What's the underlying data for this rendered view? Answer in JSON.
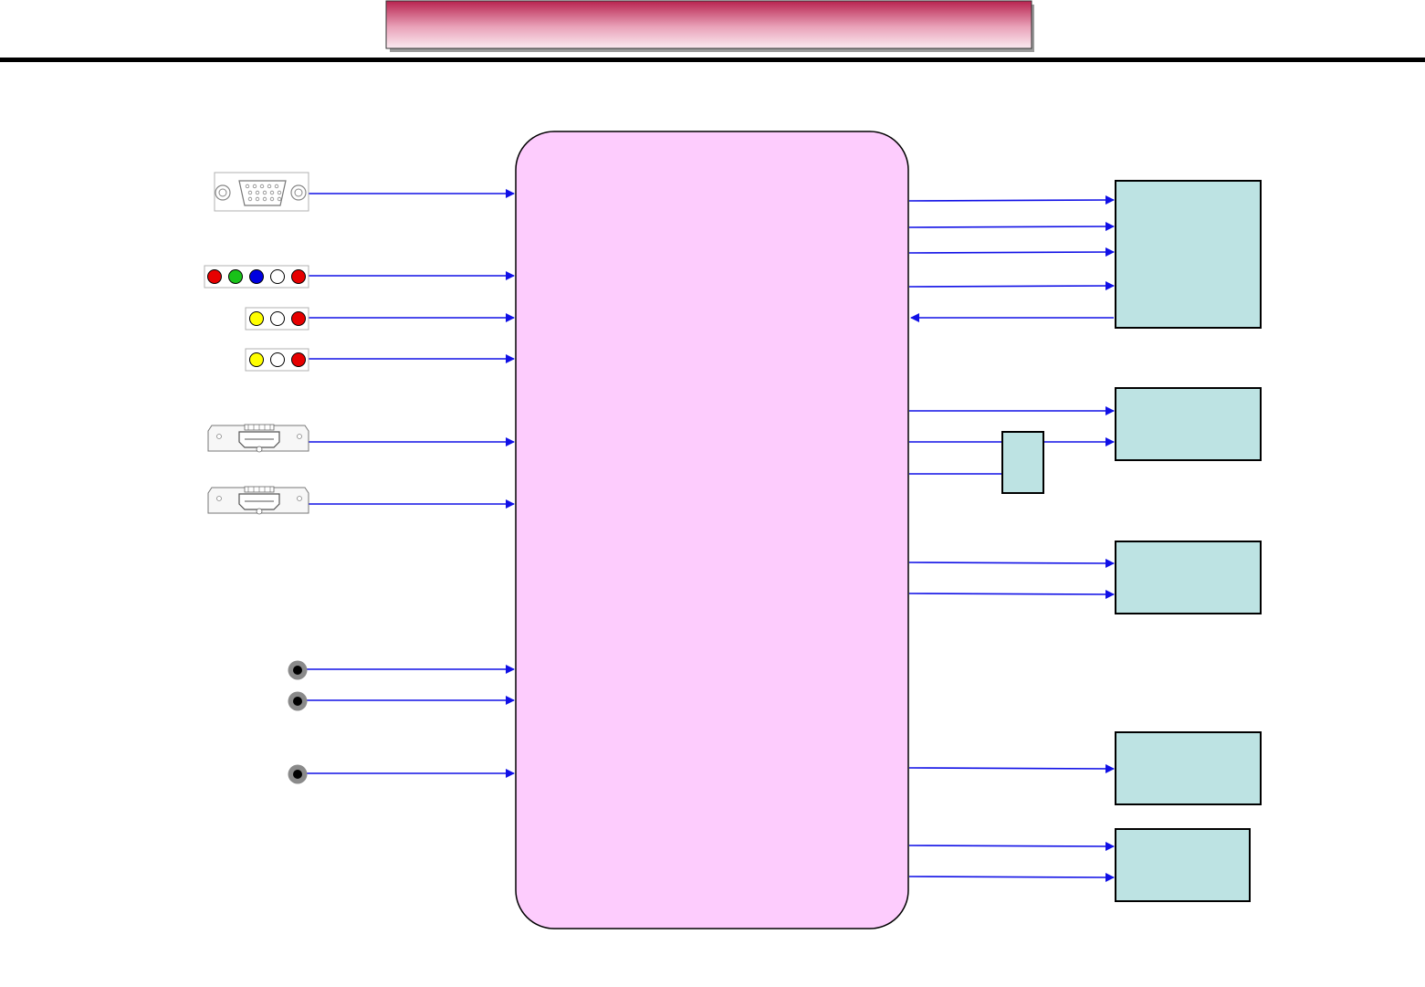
{
  "header": {
    "title": ""
  },
  "colors": {
    "processor_fill": "#fdccfd",
    "block_fill": "#bde3e3",
    "signal_line": "#1010e6",
    "banner_dark": "#b8234f",
    "banner_light": "#fbeaf0",
    "rule": "#000000"
  },
  "inputs": [
    {
      "id": "vga",
      "icon": "vga-connector-icon"
    },
    {
      "id": "component",
      "icon": "component-rca-jacks-icon",
      "jacks": [
        "#e60000",
        "#19c219",
        "#0000e0",
        "#ffffff",
        "#e60000"
      ]
    },
    {
      "id": "av1",
      "icon": "av-rca-jacks-icon",
      "jacks": [
        "#ffff00",
        "#ffffff",
        "#e60000"
      ]
    },
    {
      "id": "av2",
      "icon": "av-rca-jacks-icon",
      "jacks": [
        "#ffff00",
        "#ffffff",
        "#e60000"
      ]
    },
    {
      "id": "hdmi1",
      "icon": "hdmi-connector-icon"
    },
    {
      "id": "hdmi2",
      "icon": "hdmi-connector-icon"
    },
    {
      "id": "audio1",
      "icon": "audio-jack-icon"
    },
    {
      "id": "audio2",
      "icon": "audio-jack-icon"
    },
    {
      "id": "audio3",
      "icon": "audio-jack-icon"
    }
  ],
  "output_blocks": [
    {
      "id": "block-1",
      "label": ""
    },
    {
      "id": "block-2",
      "label": ""
    },
    {
      "id": "block-3",
      "label": ""
    },
    {
      "id": "block-4",
      "label": ""
    },
    {
      "id": "block-5",
      "label": ""
    },
    {
      "id": "small-block",
      "label": ""
    }
  ]
}
